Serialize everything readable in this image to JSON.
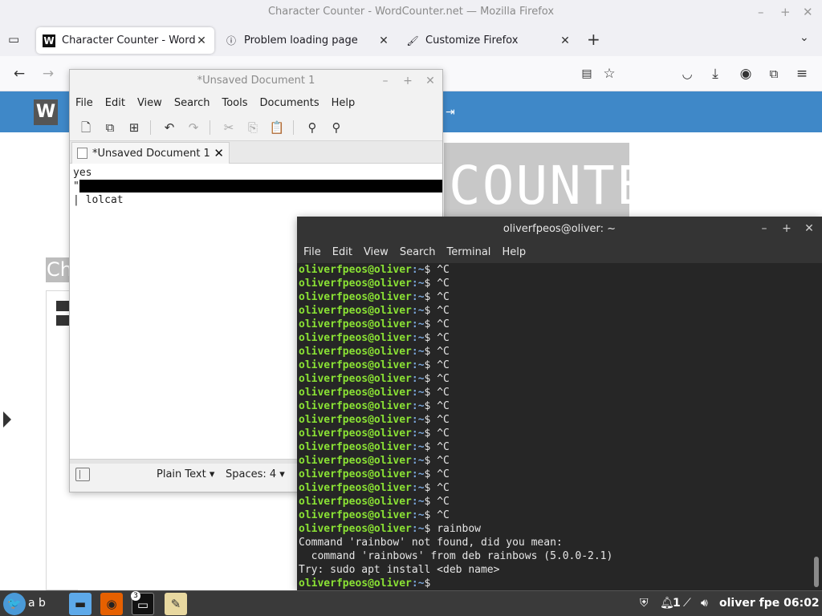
{
  "firefox": {
    "window_title": "Character Counter - WordCounter.net — Mozilla Firefox",
    "tabs": [
      {
        "label": "Character Counter - WordCounter.net",
        "icon": "W",
        "active": true
      },
      {
        "label": "Problem loading page",
        "icon": "ⓘ",
        "active": false
      },
      {
        "label": "Customize Firefox",
        "icon": "🖌",
        "active": false
      }
    ],
    "page": {
      "logo_text": "W",
      "counter_text": "COUNTER",
      "side_label": "Ch",
      "colors": {
        "band": "#3f88c8"
      }
    }
  },
  "mousepad": {
    "window_title": "*Unsaved Document 1",
    "menu": [
      "File",
      "Edit",
      "View",
      "Search",
      "Tools",
      "Documents",
      "Help"
    ],
    "tab_label": "*Unsaved Document 1",
    "lines": [
      "yes",
      "\"",
      "| lolcat"
    ],
    "status": {
      "language": "Plain Text",
      "spaces": "Spaces: 4"
    }
  },
  "terminal": {
    "window_title": "oliverfpeos@oliver: ~",
    "menu": [
      "File",
      "Edit",
      "View",
      "Search",
      "Terminal",
      "Help"
    ],
    "prompt_user": "oliverfpeos@oliver",
    "prompt_path": ":~",
    "prompt_suffix": "$ ",
    "lines": [
      {
        "type": "prompt",
        "cmd": "^C"
      },
      {
        "type": "prompt",
        "cmd": "^C"
      },
      {
        "type": "prompt",
        "cmd": "^C"
      },
      {
        "type": "prompt",
        "cmd": "^C"
      },
      {
        "type": "prompt",
        "cmd": "^C"
      },
      {
        "type": "prompt",
        "cmd": "^C"
      },
      {
        "type": "prompt",
        "cmd": "^C"
      },
      {
        "type": "prompt",
        "cmd": "^C"
      },
      {
        "type": "prompt",
        "cmd": "^C"
      },
      {
        "type": "prompt",
        "cmd": "^C"
      },
      {
        "type": "prompt",
        "cmd": "^C"
      },
      {
        "type": "prompt",
        "cmd": "^C"
      },
      {
        "type": "prompt",
        "cmd": "^C"
      },
      {
        "type": "prompt",
        "cmd": "^C"
      },
      {
        "type": "prompt",
        "cmd": "^C"
      },
      {
        "type": "prompt",
        "cmd": "^C"
      },
      {
        "type": "prompt",
        "cmd": "^C"
      },
      {
        "type": "prompt",
        "cmd": "^C"
      },
      {
        "type": "prompt",
        "cmd": "^C"
      },
      {
        "type": "prompt",
        "cmd": "rainbow"
      },
      {
        "type": "out",
        "text": "Command 'rainbow' not found, did you mean:"
      },
      {
        "type": "out",
        "text": "  command 'rainbows' from deb rainbows (5.0.0-2.1)"
      },
      {
        "type": "out",
        "text": "Try: sudo apt install <deb name>"
      },
      {
        "type": "prompt",
        "cmd": ""
      }
    ]
  },
  "taskbar": {
    "menu_label": "a b",
    "badge": "3",
    "user_label": "oliver fpe",
    "clock": "06:02",
    "notif_count": "1"
  }
}
